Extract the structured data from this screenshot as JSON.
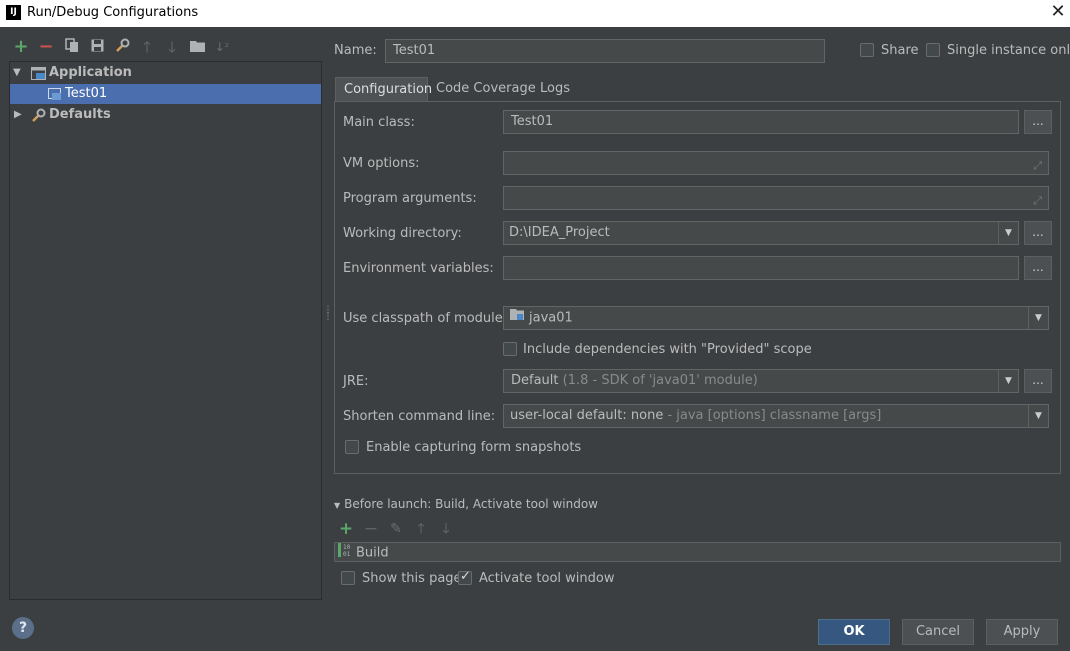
{
  "window": {
    "title": "Run/Debug Configurations",
    "app_icon": "IJ"
  },
  "toolbar": {
    "icons": [
      "add-icon",
      "remove-icon",
      "copy-icon",
      "save-icon",
      "wrench-icon",
      "move-up-icon",
      "move-down-icon",
      "folder-icon",
      "sort-icon"
    ]
  },
  "tree": {
    "items": [
      {
        "label": "Application",
        "expanded": true,
        "icon": "application-icon"
      },
      {
        "label": "Test01",
        "selected": true,
        "icon": "run-config-icon"
      },
      {
        "label": "Defaults",
        "expanded": false,
        "icon": "wrench-icon"
      }
    ]
  },
  "header": {
    "name_label": "Name:",
    "name_value": "Test01",
    "share_label": "Share",
    "share_checked": false,
    "single_instance_label": "Single instance only",
    "single_instance_checked": false
  },
  "tabs": [
    {
      "label": "Configuration",
      "active": true
    },
    {
      "label": "Code Coverage",
      "active": false
    },
    {
      "label": "Logs",
      "active": false
    }
  ],
  "config": {
    "main_class_label": "Main class:",
    "main_class_value": "Test01",
    "vm_options_label": "VM options:",
    "vm_options_value": "",
    "program_args_label": "Program arguments:",
    "program_args_value": "",
    "working_dir_label": "Working directory:",
    "working_dir_value": "D:\\IDEA_Project",
    "env_vars_label": "Environment variables:",
    "env_vars_value": "",
    "classpath_label": "Use classpath of module:",
    "classpath_value": "java01",
    "include_deps_label": "Include dependencies with \"Provided\" scope",
    "include_deps_checked": false,
    "jre_label": "JRE:",
    "jre_value": "Default",
    "jre_detail": "(1.8 - SDK of 'java01' module)",
    "shorten_label": "Shorten command line:",
    "shorten_value": "user-local default: none",
    "shorten_detail": " - java [options] classname [args]",
    "snapshots_label": "Enable capturing form snapshots",
    "snapshots_checked": false,
    "ellipsis": "..."
  },
  "before_launch": {
    "title": "Before launch: Build, Activate tool window",
    "items": [
      "Build"
    ],
    "show_page_label": "Show this page",
    "show_page_checked": false,
    "activate_label": "Activate tool window",
    "activate_checked": true
  },
  "footer": {
    "help": "?",
    "ok": "OK",
    "cancel": "Cancel",
    "apply": "Apply"
  },
  "colors": {
    "background": "#3c3f41",
    "selection": "#4b6eaf",
    "primary_button": "#365880",
    "add_green": "#59a869",
    "remove_red": "#c75450"
  }
}
